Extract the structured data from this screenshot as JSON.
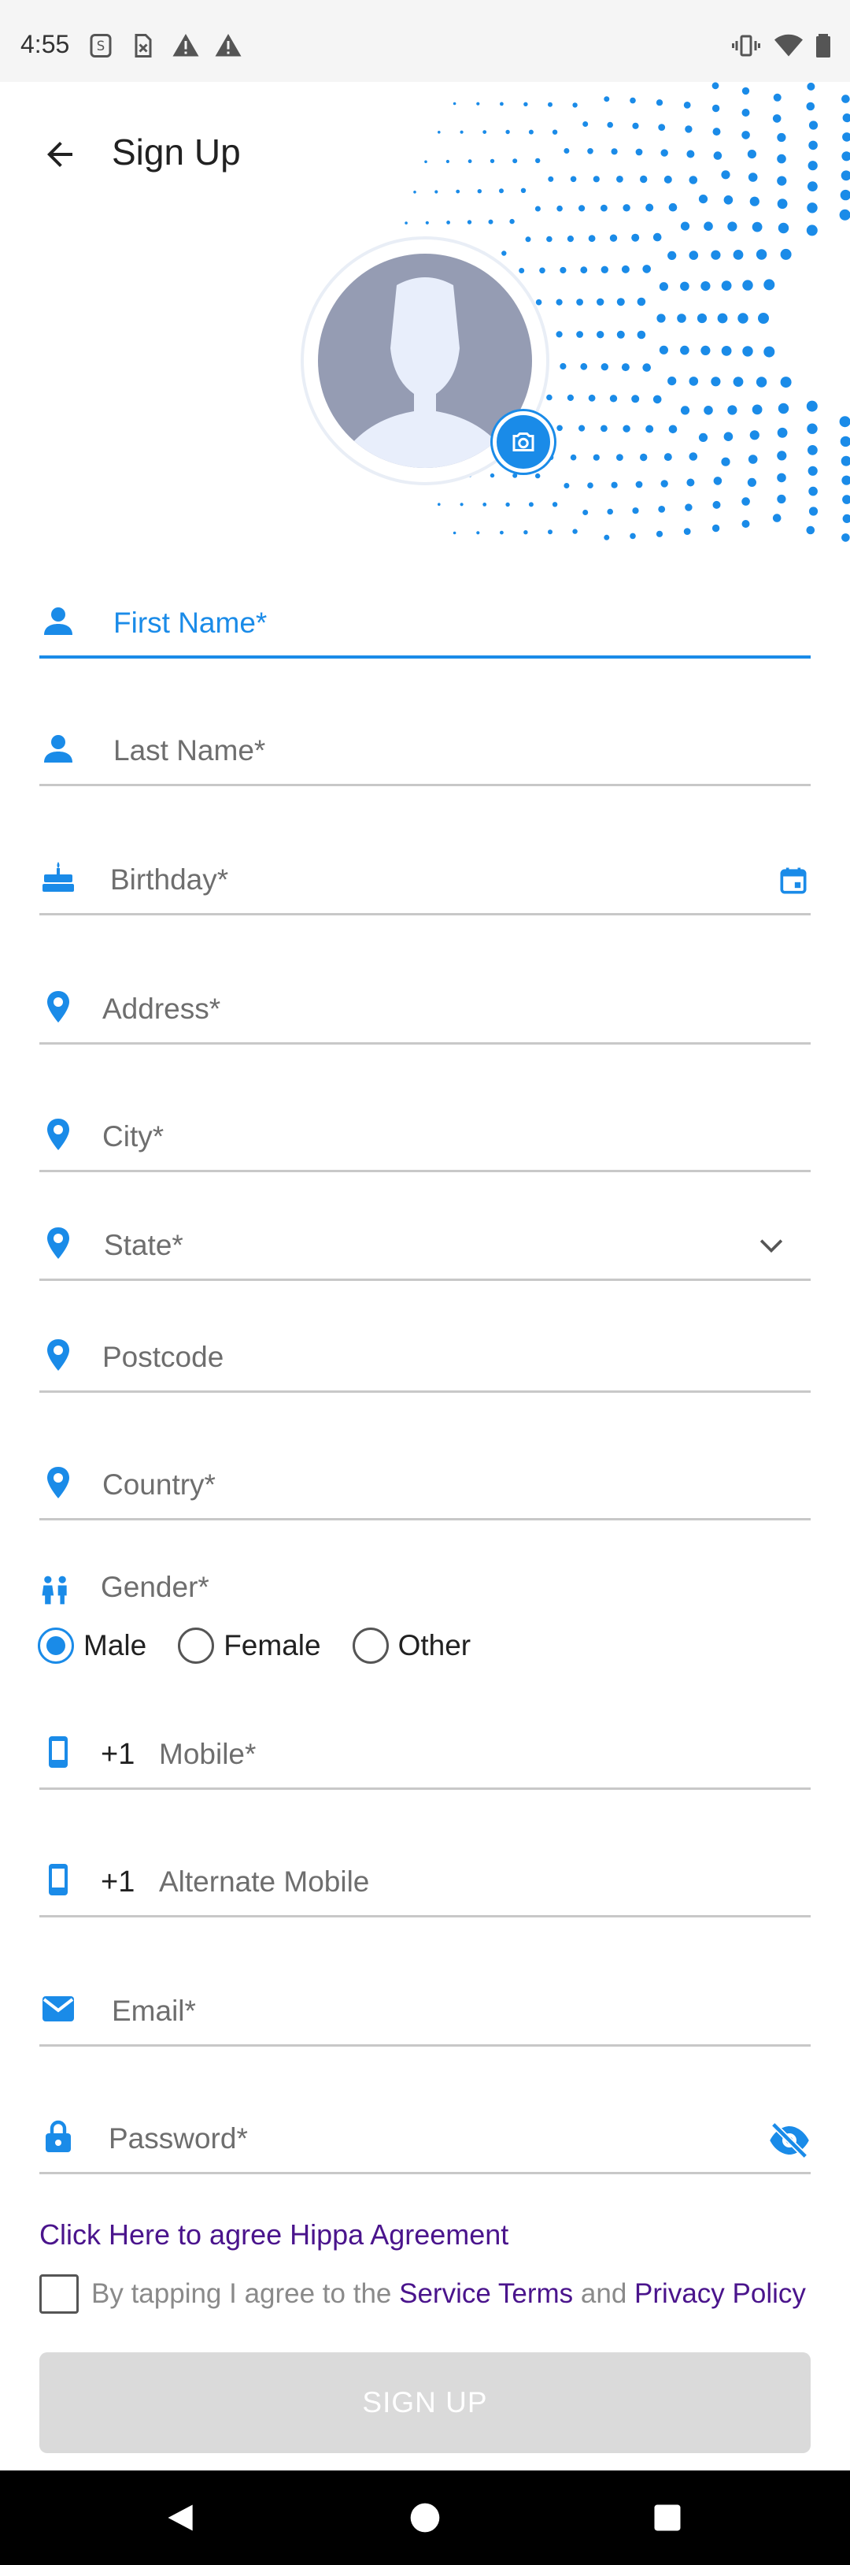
{
  "status_bar": {
    "time": "4:55",
    "left_icons": [
      "s-icon",
      "sim-off-icon",
      "warning-icon",
      "warning-icon"
    ],
    "right_icons": [
      "vibrate-icon",
      "wifi-icon",
      "battery-icon"
    ]
  },
  "app_bar": {
    "title": "Sign Up"
  },
  "colors": {
    "accent": "#1a8be8",
    "link": "#4a148c",
    "avatar_bg": "#959cb3",
    "button_disabled": "#dadada"
  },
  "form": {
    "first_name": {
      "label": "First Name*",
      "icon": "person-icon"
    },
    "last_name": {
      "label": "Last Name*",
      "icon": "person-icon"
    },
    "birthday": {
      "label": "Birthday*",
      "icon": "cake-icon",
      "trailing_icon": "calendar-icon"
    },
    "address": {
      "label": "Address*",
      "icon": "location-icon"
    },
    "city": {
      "label": "City*",
      "icon": "location-icon"
    },
    "state": {
      "label": "State*",
      "icon": "location-icon",
      "trailing_icon": "chevron-down-icon"
    },
    "postcode": {
      "label": "Postcode",
      "icon": "location-icon"
    },
    "country": {
      "label": "Country*",
      "icon": "location-icon"
    },
    "gender": {
      "label": "Gender*",
      "icon": "people-icon",
      "options": [
        "Male",
        "Female",
        "Other"
      ],
      "selected": "Male"
    },
    "mobile": {
      "prefix": "+1",
      "label": "Mobile*",
      "icon": "phone-icon"
    },
    "alt_mobile": {
      "prefix": "+1",
      "label": "Alternate Mobile",
      "icon": "phone-icon"
    },
    "email": {
      "label": "Email*",
      "icon": "mail-icon"
    },
    "password": {
      "label": "Password*",
      "icon": "lock-icon",
      "trailing_icon": "visibility-off-icon"
    }
  },
  "agreements": {
    "hippa_link": "Click Here to agree Hippa Agreement",
    "terms_prefix": "By tapping I agree to the ",
    "service_terms": "Service Terms",
    "terms_and": " and ",
    "privacy_policy": "Privacy Policy"
  },
  "signup_button": "SIGN UP"
}
